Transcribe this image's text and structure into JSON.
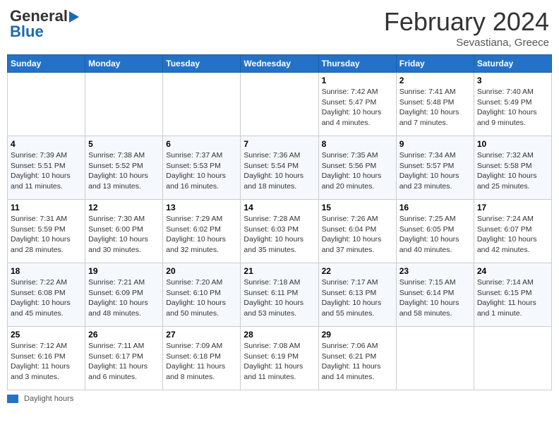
{
  "header": {
    "logo_general": "General",
    "logo_blue": "Blue",
    "month": "February 2024",
    "location": "Sevastiana, Greece"
  },
  "columns": [
    "Sunday",
    "Monday",
    "Tuesday",
    "Wednesday",
    "Thursday",
    "Friday",
    "Saturday"
  ],
  "weeks": [
    [
      {
        "day": "",
        "info": ""
      },
      {
        "day": "",
        "info": ""
      },
      {
        "day": "",
        "info": ""
      },
      {
        "day": "",
        "info": ""
      },
      {
        "day": "1",
        "info": "Sunrise: 7:42 AM\nSunset: 5:47 PM\nDaylight: 10 hours\nand 4 minutes."
      },
      {
        "day": "2",
        "info": "Sunrise: 7:41 AM\nSunset: 5:48 PM\nDaylight: 10 hours\nand 7 minutes."
      },
      {
        "day": "3",
        "info": "Sunrise: 7:40 AM\nSunset: 5:49 PM\nDaylight: 10 hours\nand 9 minutes."
      }
    ],
    [
      {
        "day": "4",
        "info": "Sunrise: 7:39 AM\nSunset: 5:51 PM\nDaylight: 10 hours\nand 11 minutes."
      },
      {
        "day": "5",
        "info": "Sunrise: 7:38 AM\nSunset: 5:52 PM\nDaylight: 10 hours\nand 13 minutes."
      },
      {
        "day": "6",
        "info": "Sunrise: 7:37 AM\nSunset: 5:53 PM\nDaylight: 10 hours\nand 16 minutes."
      },
      {
        "day": "7",
        "info": "Sunrise: 7:36 AM\nSunset: 5:54 PM\nDaylight: 10 hours\nand 18 minutes."
      },
      {
        "day": "8",
        "info": "Sunrise: 7:35 AM\nSunset: 5:56 PM\nDaylight: 10 hours\nand 20 minutes."
      },
      {
        "day": "9",
        "info": "Sunrise: 7:34 AM\nSunset: 5:57 PM\nDaylight: 10 hours\nand 23 minutes."
      },
      {
        "day": "10",
        "info": "Sunrise: 7:32 AM\nSunset: 5:58 PM\nDaylight: 10 hours\nand 25 minutes."
      }
    ],
    [
      {
        "day": "11",
        "info": "Sunrise: 7:31 AM\nSunset: 5:59 PM\nDaylight: 10 hours\nand 28 minutes."
      },
      {
        "day": "12",
        "info": "Sunrise: 7:30 AM\nSunset: 6:00 PM\nDaylight: 10 hours\nand 30 minutes."
      },
      {
        "day": "13",
        "info": "Sunrise: 7:29 AM\nSunset: 6:02 PM\nDaylight: 10 hours\nand 32 minutes."
      },
      {
        "day": "14",
        "info": "Sunrise: 7:28 AM\nSunset: 6:03 PM\nDaylight: 10 hours\nand 35 minutes."
      },
      {
        "day": "15",
        "info": "Sunrise: 7:26 AM\nSunset: 6:04 PM\nDaylight: 10 hours\nand 37 minutes."
      },
      {
        "day": "16",
        "info": "Sunrise: 7:25 AM\nSunset: 6:05 PM\nDaylight: 10 hours\nand 40 minutes."
      },
      {
        "day": "17",
        "info": "Sunrise: 7:24 AM\nSunset: 6:07 PM\nDaylight: 10 hours\nand 42 minutes."
      }
    ],
    [
      {
        "day": "18",
        "info": "Sunrise: 7:22 AM\nSunset: 6:08 PM\nDaylight: 10 hours\nand 45 minutes."
      },
      {
        "day": "19",
        "info": "Sunrise: 7:21 AM\nSunset: 6:09 PM\nDaylight: 10 hours\nand 48 minutes."
      },
      {
        "day": "20",
        "info": "Sunrise: 7:20 AM\nSunset: 6:10 PM\nDaylight: 10 hours\nand 50 minutes."
      },
      {
        "day": "21",
        "info": "Sunrise: 7:18 AM\nSunset: 6:11 PM\nDaylight: 10 hours\nand 53 minutes."
      },
      {
        "day": "22",
        "info": "Sunrise: 7:17 AM\nSunset: 6:13 PM\nDaylight: 10 hours\nand 55 minutes."
      },
      {
        "day": "23",
        "info": "Sunrise: 7:15 AM\nSunset: 6:14 PM\nDaylight: 10 hours\nand 58 minutes."
      },
      {
        "day": "24",
        "info": "Sunrise: 7:14 AM\nSunset: 6:15 PM\nDaylight: 11 hours\nand 1 minute."
      }
    ],
    [
      {
        "day": "25",
        "info": "Sunrise: 7:12 AM\nSunset: 6:16 PM\nDaylight: 11 hours\nand 3 minutes."
      },
      {
        "day": "26",
        "info": "Sunrise: 7:11 AM\nSunset: 6:17 PM\nDaylight: 11 hours\nand 6 minutes."
      },
      {
        "day": "27",
        "info": "Sunrise: 7:09 AM\nSunset: 6:18 PM\nDaylight: 11 hours\nand 8 minutes."
      },
      {
        "day": "28",
        "info": "Sunrise: 7:08 AM\nSunset: 6:19 PM\nDaylight: 11 hours\nand 11 minutes."
      },
      {
        "day": "29",
        "info": "Sunrise: 7:06 AM\nSunset: 6:21 PM\nDaylight: 11 hours\nand 14 minutes."
      },
      {
        "day": "",
        "info": ""
      },
      {
        "day": "",
        "info": ""
      }
    ]
  ],
  "footer": {
    "legend_label": "Daylight hours"
  }
}
